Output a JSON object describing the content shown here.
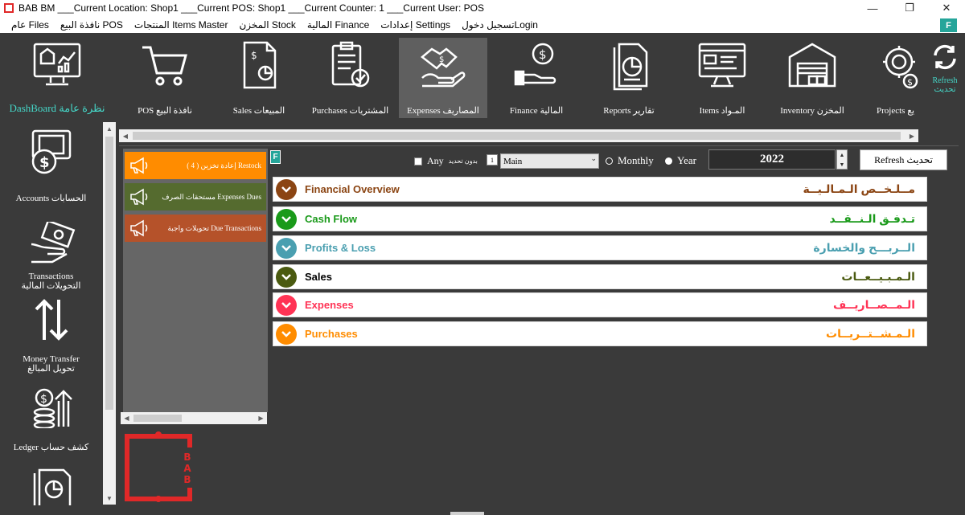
{
  "window": {
    "title": "BAB BM ___Current Location: Shop1 ___Current POS: Shop1 ___Current Counter: 1 ___Current User: POS"
  },
  "menu": [
    "عام Files",
    "نافذة البيع POS",
    "المنتجات Items Master",
    "المخزن Stock",
    "المالية Finance",
    "إعدادات Settings",
    "تسجيل دخولLogin"
  ],
  "menu_badge": "F",
  "toolbar": {
    "dashboard": "DashBoard نظرة عامة",
    "pos": "POS   نافذة البيع",
    "sales": "Sales   المبيعات",
    "purchases": "Purchases   المشتريات",
    "expenses": "Expenses   المصاريف",
    "finance": "Finance   المالية",
    "reports": "Reports   تقارير",
    "items": "Items   المـواد",
    "inventory": "Inventory   المخزن",
    "projects": "Projects   يع",
    "refresh_en": "Refresh",
    "refresh_ar": "تحديث"
  },
  "leftnav": {
    "accounts": "Accounts  الحسابات",
    "transactions_en": "Transactions",
    "transactions_ar": "التحويلات المالية",
    "money_en": "Money Transfer",
    "money_ar": "تحويل المبالغ",
    "ledger": "Ledger  كشف حساب"
  },
  "alerts": {
    "restock": "إعادة تخزين ( 4 )   Restock",
    "expenses_dues": "مستحقات الصرف   Expenses Dues",
    "due_transactions": "تحويلات واجبة   Due Transactions",
    "colors": {
      "restock": "#ff8c00",
      "expenses_dues": "#556b2f",
      "due_transactions": "#b5522a"
    }
  },
  "filters": {
    "badge": "F",
    "any_label": "Any",
    "any_ar": "بدون تحديد",
    "qty_value": "1",
    "select_value": "Main",
    "monthly": "Monthly",
    "year_label": "Year",
    "year_value": "2022",
    "refresh_button": "Refresh  تحديث"
  },
  "summary": [
    {
      "en": "Financial Overview",
      "ar": "مــلـخــص الـمـالـيــة",
      "color": "#8b4513"
    },
    {
      "en": "Cash Flow",
      "ar": "تـدفـق الـنــقــد",
      "color": "#1a9a1a"
    },
    {
      "en": "Profits & Loss",
      "ar": "الــربـــح والخسارة",
      "color": "#4a9fb0"
    },
    {
      "en": "Sales",
      "ar": "الـمـبـيــعــات",
      "color": "#4a5a10"
    },
    {
      "en": "Expenses",
      "ar": "الـمــصــاريــف",
      "color": "#ff3355"
    },
    {
      "en": "Purchases",
      "ar": "الـمـشــتــريــات",
      "color": "#ff8c00"
    }
  ],
  "logo_text": "BAB"
}
